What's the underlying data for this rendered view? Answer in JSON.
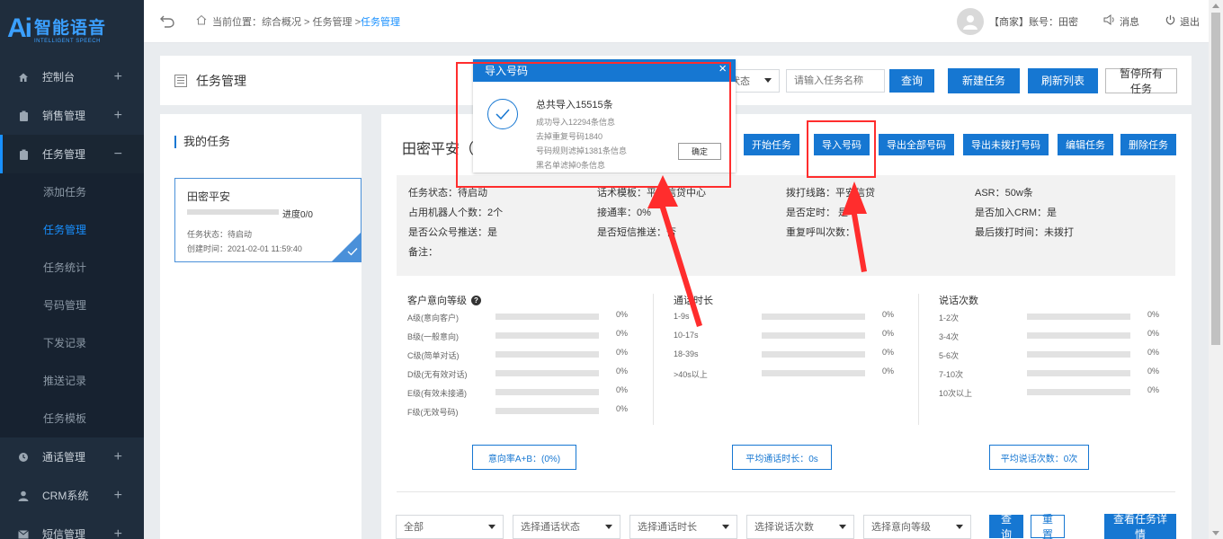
{
  "colors": {
    "accent": "#1677d2",
    "sidebar_bg": "#1f2d3d",
    "annotation": "#ff2d2d"
  },
  "logo": {
    "mark": "Ai",
    "title": "智能语音",
    "subtitle": "INTELLIGENT SPEECH"
  },
  "sidebar": {
    "items": [
      {
        "label": "控制台",
        "icon": "home-icon",
        "toggle": "+"
      },
      {
        "label": "销售管理",
        "icon": "clipboard-icon",
        "toggle": "+"
      },
      {
        "label": "任务管理",
        "icon": "clipboard-icon",
        "toggle": "−"
      },
      {
        "label": "通话管理",
        "icon": "clock-icon",
        "toggle": "+"
      },
      {
        "label": "CRM系统",
        "icon": "user-icon",
        "toggle": "+"
      },
      {
        "label": "短信管理",
        "icon": "mail-icon",
        "toggle": "+"
      }
    ],
    "submenu": [
      {
        "label": "添加任务"
      },
      {
        "label": "任务管理"
      },
      {
        "label": "任务统计"
      },
      {
        "label": "号码管理"
      },
      {
        "label": "下发记录"
      },
      {
        "label": "推送记录"
      },
      {
        "label": "任务模板"
      }
    ]
  },
  "topbar": {
    "breadcrumb_prefix": "当前位置：综合概况 > 任务管理 > ",
    "breadcrumb_active": "任务管理",
    "account": "【商家】账号：田密",
    "messages": "消息",
    "logout": "退出"
  },
  "header": {
    "title": "任务管理",
    "status_select": "状态",
    "search_placeholder": "请输入任务名称",
    "query": "查询",
    "new_task": "新建任务",
    "refresh": "刷新列表",
    "pause_all": "暂停所有任务"
  },
  "left": {
    "title": "我的任务",
    "task": {
      "name": "田密平安",
      "progress_text": "进度0/0",
      "progress": 0,
      "status": "任务状态：待启动",
      "created": "创建时间：2021-02-01 11:59:40"
    }
  },
  "main": {
    "title": "田密平安（",
    "actions": [
      "开始任务",
      "导入号码",
      "导出全部号码",
      "导出未拨打号码",
      "编辑任务",
      "删除任务"
    ],
    "info": [
      "任务状态：待启动",
      "话术模板：平安信贷中心",
      "拨打线路：平安信贷",
      "ASR：50w条",
      "占用机器人个数：2个",
      "接通率：0%",
      "是否定时： 是",
      "是否加入CRM：是",
      "是否公众号推送：是",
      "是否短信推送：否",
      "重复呼叫次数：1",
      "最后拨打时间：未拨打",
      "备注：",
      "",
      "",
      ""
    ],
    "stats": [
      {
        "title": "客户意向等级",
        "help": "?",
        "rows": [
          {
            "label": "A级(意向客户)",
            "value": "0%",
            "pct": 0
          },
          {
            "label": "B级(一般意向)",
            "value": "0%",
            "pct": 0
          },
          {
            "label": "C级(简单对话)",
            "value": "0%",
            "pct": 0
          },
          {
            "label": "D级(无有效对话)",
            "value": "0%",
            "pct": 0
          },
          {
            "label": "E级(有效未接通)",
            "value": "0%",
            "pct": 0
          },
          {
            "label": "F级(无效号码)",
            "value": "0%",
            "pct": 0
          }
        ],
        "summary": "意向率A+B：(0%)"
      },
      {
        "title": "通话时长",
        "rows": [
          {
            "label": "1-9s",
            "value": "0%",
            "pct": 0
          },
          {
            "label": "10-17s",
            "value": "0%",
            "pct": 0
          },
          {
            "label": "18-39s",
            "value": "0%",
            "pct": 0
          },
          {
            "label": ">40s以上",
            "value": "0%",
            "pct": 0
          }
        ],
        "summary": "平均通话时长：0s"
      },
      {
        "title": "说话次数",
        "rows": [
          {
            "label": "1-2次",
            "value": "0%",
            "pct": 0
          },
          {
            "label": "3-4次",
            "value": "0%",
            "pct": 0
          },
          {
            "label": "5-6次",
            "value": "0%",
            "pct": 0
          },
          {
            "label": "7-10次",
            "value": "0%",
            "pct": 0
          },
          {
            "label": "10次以上",
            "value": "0%",
            "pct": 0
          }
        ],
        "summary": "平均说话次数：0次"
      }
    ],
    "filters": {
      "all": "全部",
      "call_status": "选择通话状态",
      "call_duration": "选择通话时长",
      "talk_count": "选择说话次数",
      "intent_level": "选择意向等级",
      "query": "查询",
      "reset": "重置",
      "details": "查看任务详情"
    }
  },
  "modal": {
    "title": "导入号码",
    "total": "总共导入15515条",
    "lines": [
      "成功导入12294条信息",
      "去掉重复号码1840",
      "号码规则滤掉1381条信息",
      "黑名单滤掉0条信息"
    ],
    "ok": "确定",
    "close": "×"
  }
}
